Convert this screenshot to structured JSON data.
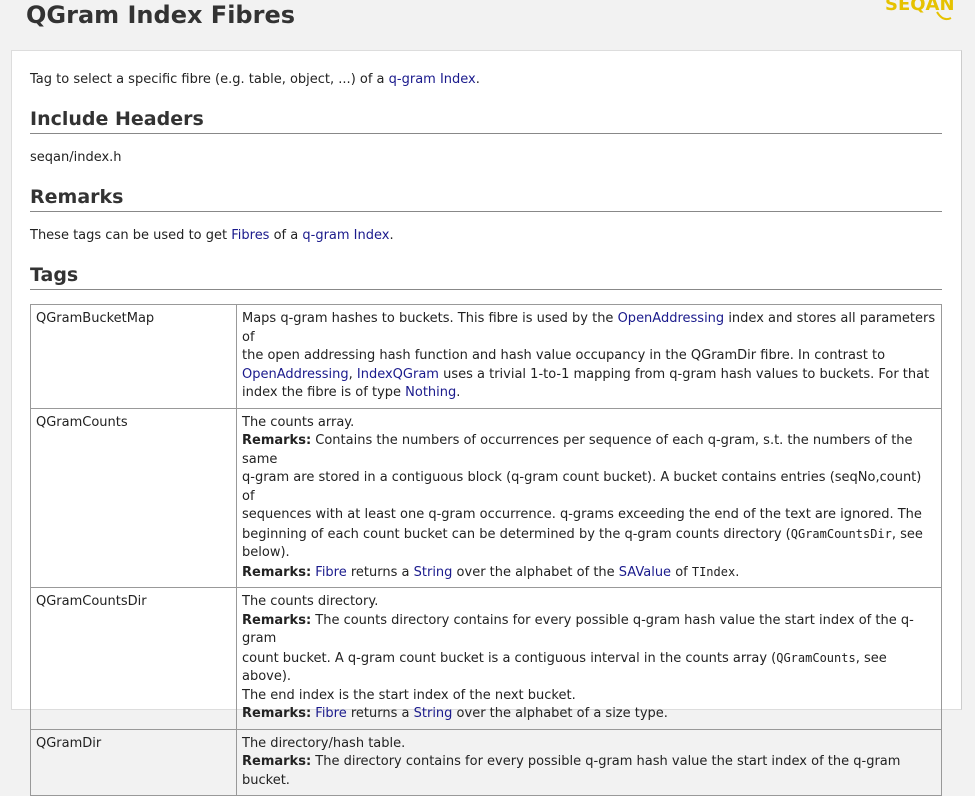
{
  "page": {
    "title": "QGram Index Fibres",
    "logo_text": "SEQAN"
  },
  "intro": {
    "before": "Tag to select a specific fibre (e.g. table, object, ...) of a ",
    "link": "q-gram Index",
    "after": "."
  },
  "include": {
    "heading": "Include Headers",
    "header_file": "seqan/index.h"
  },
  "remarks": {
    "heading": "Remarks",
    "before": "These tags can be used to get ",
    "link1": "Fibres",
    "mid": " of a ",
    "link2": "q-gram Index",
    "after": "."
  },
  "tags": {
    "heading": "Tags",
    "rows": [
      {
        "name": "QGramBucketMap",
        "d1": "Maps q-gram hashes to buckets. This fibre is used by the ",
        "d1_link": "OpenAddressing",
        "d2": " index and stores all parameters of",
        "d3": "the open addressing hash function and hash value occupancy in the QGramDir fibre. In contrast to",
        "d4_link1": "OpenAddressing",
        "d4_sep": ", ",
        "d4_link2": "IndexQGram",
        "d4_text": " uses a trivial 1-to-1 mapping from q-gram hash values to buckets. For that",
        "d5": "index the fibre is of type ",
        "d5_link": "Nothing",
        "d5_end": "."
      },
      {
        "name": "QGramCounts",
        "summary": "The counts array.",
        "remarks_label": "Remarks:",
        "r1": " Contains the numbers of occurrences per sequence of each q-gram, s.t. the numbers of the same",
        "r2": "q-gram are stored in a contiguous block (q-gram count bucket). A bucket contains entries (seqNo,count) of",
        "r3": "sequences with at least one q-gram occurrence. q-grams exceeding the end of the text are ignored. The",
        "r4a": "beginning of each count bucket can be determined by the q-gram counts directory (",
        "r4_code": "QGramCountsDir",
        "r4b": ", see",
        "r5": "below).",
        "remarks2_label": "Remarks:",
        "f_link1": "Fibre",
        "f_mid1": " returns a ",
        "f_link2": "String",
        "f_mid2": " over the alphabet of the ",
        "f_link3": "SAValue",
        "f_mid3": " of ",
        "f_code": "TIndex",
        "f_end": "."
      },
      {
        "name": "QGramCountsDir",
        "summary": "The counts directory.",
        "remarks_label": "Remarks:",
        "r1": " The counts directory contains for every possible q-gram hash value the start index of the q-gram",
        "r2a": "count bucket. A q-gram count bucket is a contiguous interval in the counts array (",
        "r2_code": "QGramCounts",
        "r2b": ", see above).",
        "r3": "The end index is the start index of the next bucket.",
        "remarks2_label": "Remarks:",
        "f_link1": "Fibre",
        "f_mid1": " returns a ",
        "f_link2": "String",
        "f_mid2": " over the alphabet of a size type."
      },
      {
        "name": "QGramDir",
        "summary": "The directory/hash table.",
        "remarks_label": "Remarks:",
        "r1": " The directory contains for every possible q-gram hash value the start index of the q-gram bucket."
      }
    ]
  },
  "colors": {
    "link": "#1a1a8c",
    "logo": "#e6c200",
    "rule": "#888888"
  }
}
